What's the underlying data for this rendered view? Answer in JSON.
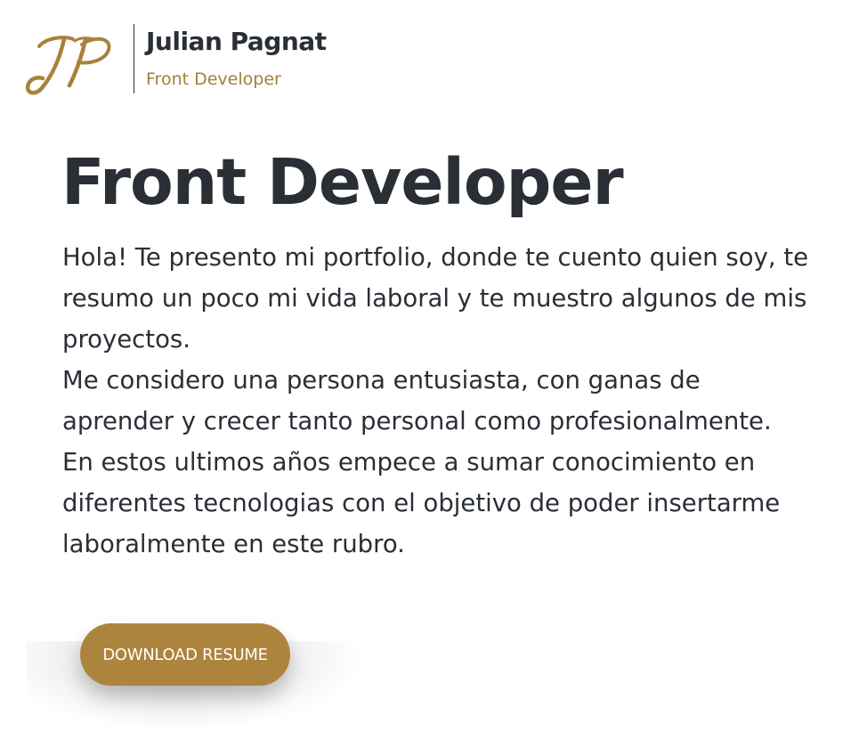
{
  "header": {
    "logo_text": "JP",
    "name": "Julian Pagnat",
    "role": "Front Developer"
  },
  "hero": {
    "title": "Front Developer",
    "paragraphs": [
      "Hola! Te presento mi portfolio, donde te cuento quien soy, te resumo un poco mi vida laboral y te muestro algunos de mis proyectos.",
      "Me considero una persona entusiasta, con ganas de aprender y crecer tanto personal como profesionalmente.",
      "En estos ultimos años empece a sumar conocimiento en diferentes tecnologias con el objetivo de poder insertarme laboralmente en este rubro."
    ],
    "button_label": "DOWNLOAD RESUME"
  },
  "colors": {
    "accent": "#ad843d",
    "text": "#2a2f36",
    "background": "#ffffff"
  }
}
